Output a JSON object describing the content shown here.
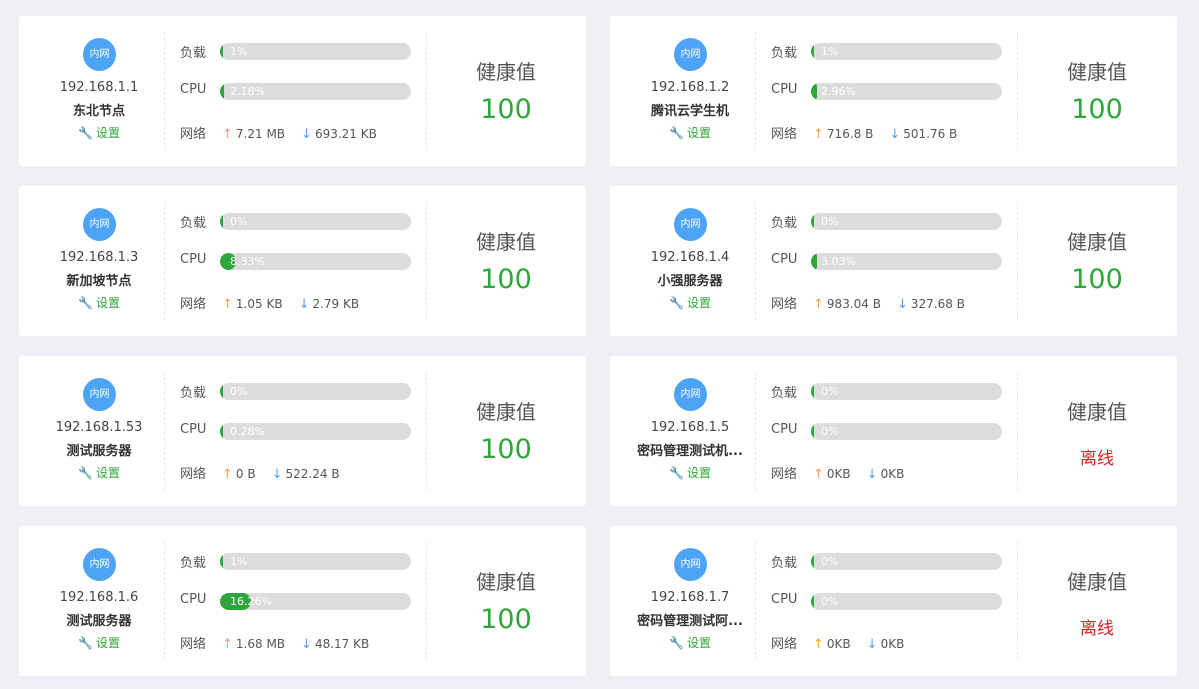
{
  "labels": {
    "load": "负载",
    "cpu": "CPU",
    "network": "网络",
    "health": "健康值",
    "settings": "设置",
    "badge": "内网"
  },
  "colors": {
    "ok": "#2fa63a",
    "offline": "#e02020",
    "badge": "#4da3f5",
    "upload": "#f5a34a",
    "download": "#4da3f5"
  },
  "icons": {
    "settings": "wrench-icon",
    "upload": "arrow-up-icon",
    "download": "arrow-down-icon"
  },
  "nodes": [
    {
      "ip": "192.168.1.1",
      "name": "东北节点",
      "load": 1,
      "load_text": "1%",
      "cpu": 2.18,
      "cpu_text": "2.18%",
      "up": "7.21 MB",
      "down": "693.21 KB",
      "health": "100",
      "offline": false
    },
    {
      "ip": "192.168.1.2",
      "name": "腾讯云学生机",
      "load": 1,
      "load_text": "1%",
      "cpu": 2.96,
      "cpu_text": "2.96%",
      "up": "716.8 B",
      "down": "501.76 B",
      "health": "100",
      "offline": false
    },
    {
      "ip": "192.168.1.3",
      "name": "新加坡节点",
      "load": 0,
      "load_text": "0%",
      "cpu": 8.33,
      "cpu_text": "8.33%",
      "up": "1.05 KB",
      "down": "2.79 KB",
      "health": "100",
      "offline": false
    },
    {
      "ip": "192.168.1.4",
      "name": "小强服务器",
      "load": 0,
      "load_text": "0%",
      "cpu": 3.03,
      "cpu_text": "3.03%",
      "up": "983.04 B",
      "down": "327.68 B",
      "health": "100",
      "offline": false
    },
    {
      "ip": "192.168.1.53",
      "name": "测试服务器",
      "load": 0,
      "load_text": "0%",
      "cpu": 0.28,
      "cpu_text": "0.28%",
      "up": "0 B",
      "down": "522.24 B",
      "health": "100",
      "offline": false
    },
    {
      "ip": "192.168.1.5",
      "name": "密码管理测试机...",
      "load": 0,
      "load_text": "0%",
      "cpu": 0,
      "cpu_text": "0%",
      "up": "0KB",
      "down": "0KB",
      "health": "离线",
      "offline": true
    },
    {
      "ip": "192.168.1.6",
      "name": "测试服务器",
      "load": 1,
      "load_text": "1%",
      "cpu": 16.26,
      "cpu_text": "16.26%",
      "up": "1.68 MB",
      "down": "48.17 KB",
      "health": "100",
      "offline": false
    },
    {
      "ip": "192.168.1.7",
      "name": "密码管理测试阿...",
      "load": 0,
      "load_text": "0%",
      "cpu": 0,
      "cpu_text": "0%",
      "up": "0KB",
      "down": "0KB",
      "health": "离线",
      "offline": true
    }
  ]
}
